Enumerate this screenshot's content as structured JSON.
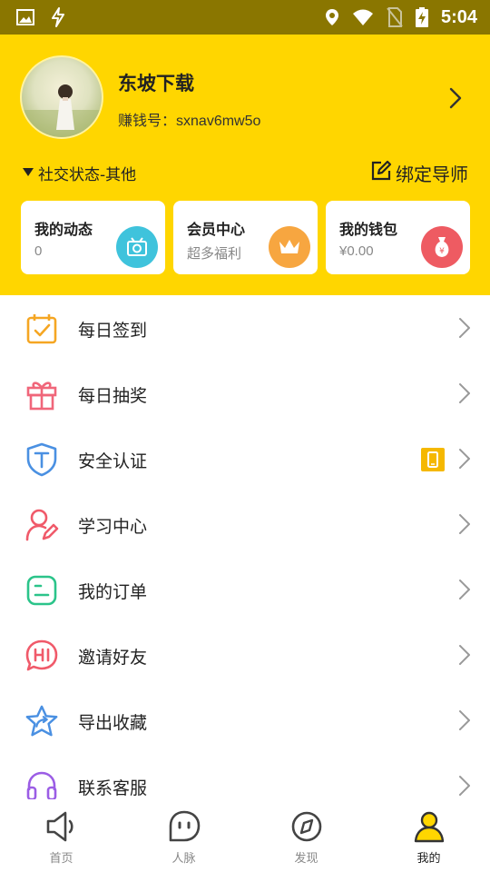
{
  "status_bar": {
    "time": "5:04",
    "icons": [
      "image-icon",
      "bolt-icon",
      "location-icon",
      "wifi-icon",
      "no-sim-icon",
      "battery-charging-icon"
    ]
  },
  "profile": {
    "username": "东坡下载",
    "earn_label": "赚钱号：",
    "earn_id": "sxnav6mw5o",
    "social_status": "社交状态-其他",
    "bind_mentor": "绑定导师"
  },
  "cards": [
    {
      "title": "我的动态",
      "subtitle": "0",
      "icon": "camera-icon",
      "color": "#3fc3dc"
    },
    {
      "title": "会员中心",
      "subtitle": "超多福利",
      "icon": "crown-icon",
      "color": "#f7a640"
    },
    {
      "title": "我的钱包",
      "subtitle": "¥0.00",
      "icon": "money-bag-icon",
      "color": "#ee5b62"
    }
  ],
  "menu": [
    {
      "label": "每日签到",
      "icon": "calendar-check-icon",
      "color": "#f5a623"
    },
    {
      "label": "每日抽奖",
      "icon": "gift-icon",
      "color": "#f0667a"
    },
    {
      "label": "安全认证",
      "icon": "shield-t-icon",
      "color": "#4a90e2",
      "badge": "phone-icon"
    },
    {
      "label": "学习中心",
      "icon": "user-pen-icon",
      "color": "#f05a6a"
    },
    {
      "label": "我的订单",
      "icon": "order-icon",
      "color": "#2bc48a"
    },
    {
      "label": "邀请好友",
      "icon": "hi-bubble-icon",
      "color": "#f05a6a"
    },
    {
      "label": "导出收藏",
      "icon": "star-share-icon",
      "color": "#4a90e2"
    },
    {
      "label": "联系客服",
      "icon": "headset-icon",
      "color": "#9b5de5"
    }
  ],
  "bottom_nav": [
    {
      "label": "首页",
      "icon": "speaker-icon",
      "active": false
    },
    {
      "label": "人脉",
      "icon": "chat-face-icon",
      "active": false
    },
    {
      "label": "发现",
      "icon": "compass-icon",
      "active": false
    },
    {
      "label": "我的",
      "icon": "person-icon",
      "active": true
    }
  ],
  "colors": {
    "status_bar": "#8a7600",
    "header": "#ffd600",
    "badge": "#f5b800"
  }
}
